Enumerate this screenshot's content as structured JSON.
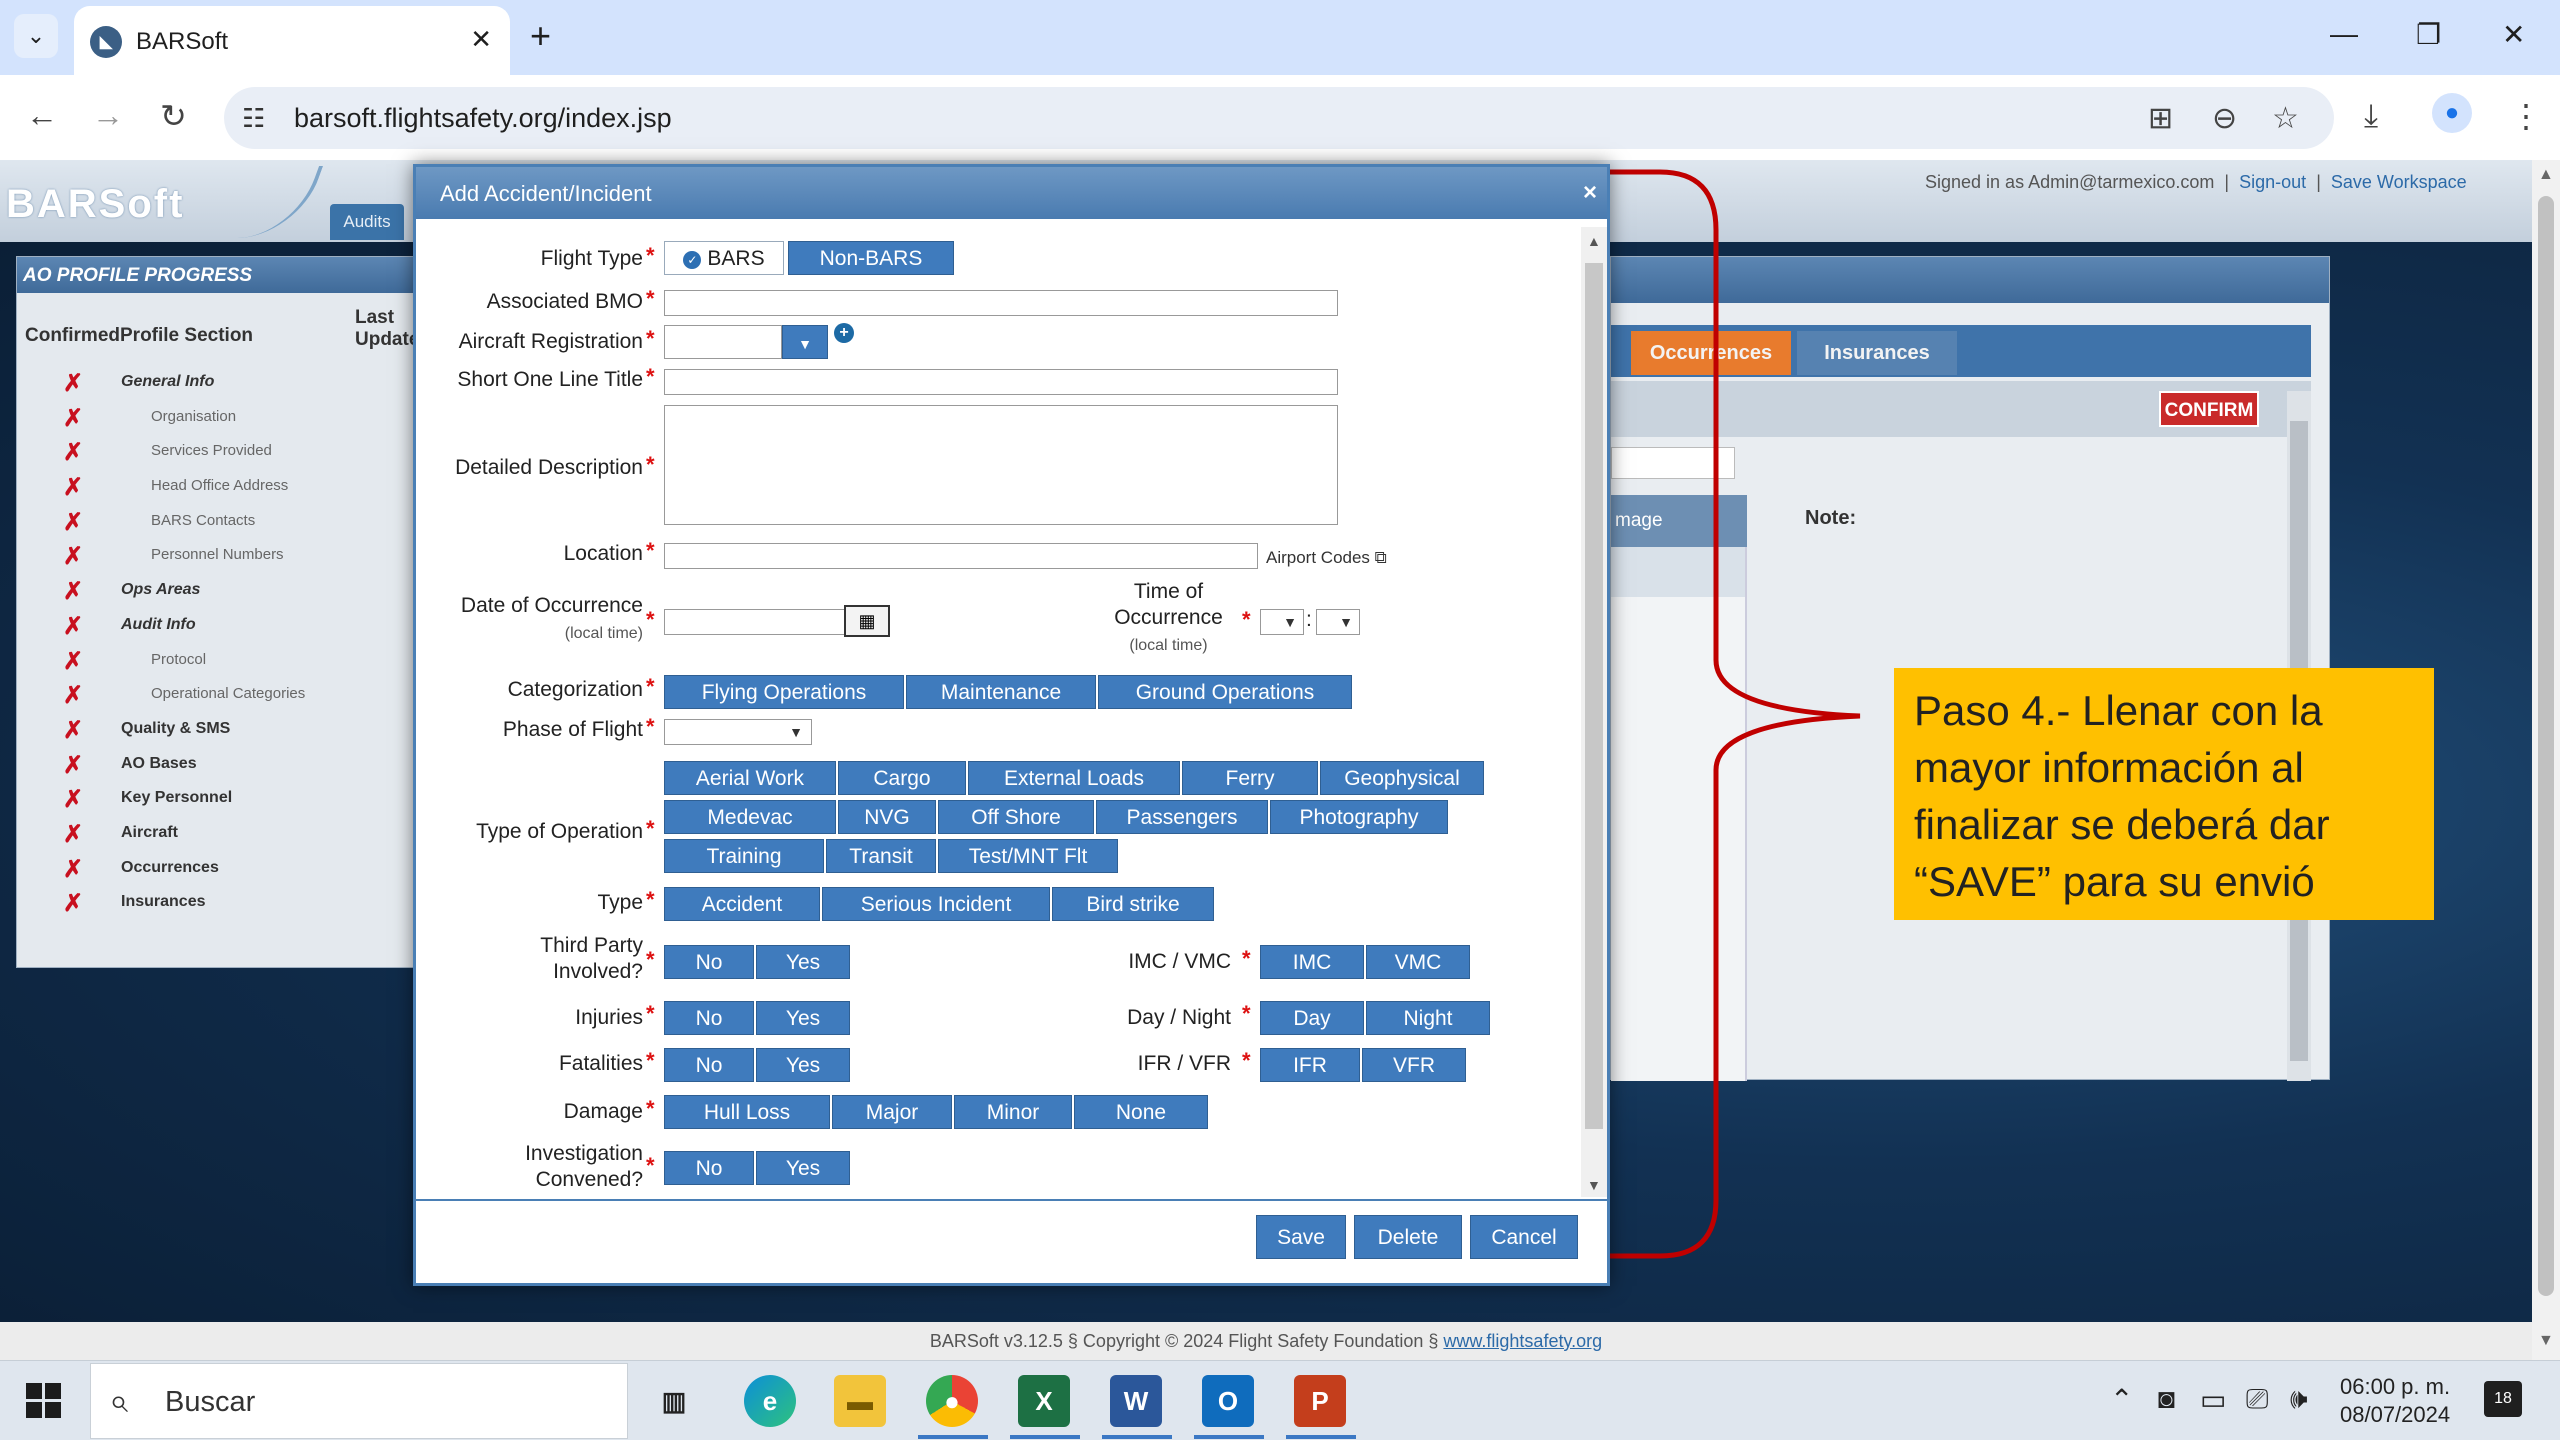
{
  "browser": {
    "tab_title": "BARSoft",
    "url": "barsoft.flightsafety.org/index.jsp"
  },
  "app": {
    "logo": "BARSoft",
    "audits_tab": "Audits",
    "signed_in": "Signed in as Admin@tarmexico.com",
    "sign_out": "Sign-out",
    "save_workspace": "Save Workspace",
    "separator": "|",
    "footer_prefix": "BARSoft v3.12.5 § Copyright © 2024 Flight Safety Foundation § ",
    "footer_link": "www.flightsafety.org"
  },
  "progress": {
    "title": "AO PROFILE PROGRESS",
    "col_section": "ConfirmedProfile Section",
    "col_last": "Last Update",
    "x_mark": "✗",
    "items": [
      {
        "label": "General Info",
        "kind": "main-it"
      },
      {
        "label": "Organisation",
        "kind": "sub"
      },
      {
        "label": "Services Provided",
        "kind": "sub"
      },
      {
        "label": "Head Office Address",
        "kind": "sub"
      },
      {
        "label": "BARS Contacts",
        "kind": "sub"
      },
      {
        "label": "Personnel Numbers",
        "kind": "sub"
      },
      {
        "label": "Ops Areas",
        "kind": "main-it"
      },
      {
        "label": "Audit Info",
        "kind": "main-it"
      },
      {
        "label": "Protocol",
        "kind": "sub"
      },
      {
        "label": "Operational Categories",
        "kind": "sub"
      },
      {
        "label": "Quality & SMS",
        "kind": "main"
      },
      {
        "label": "AO Bases",
        "kind": "main"
      },
      {
        "label": "Key Personnel",
        "kind": "main"
      },
      {
        "label": "Aircraft",
        "kind": "main"
      },
      {
        "label": "Occurrences",
        "kind": "main"
      },
      {
        "label": "Insurances",
        "kind": "main"
      }
    ]
  },
  "right_panel": {
    "tab_occurrences": "Occurrences",
    "tab_insurances": "Insurances",
    "confirm": "CONFIRM",
    "col_image": "mage",
    "note": "Note:"
  },
  "modal": {
    "title": "Add Accident/Incident",
    "close": "×",
    "required_mark": "*",
    "flight_type": {
      "label": "Flight Type",
      "options": [
        "BARS",
        "Non-BARS"
      ]
    },
    "associated_bmo": {
      "label": "Associated BMO",
      "value": ""
    },
    "aircraft_registration": {
      "label": "Aircraft Registration",
      "value": ""
    },
    "short_title": {
      "label": "Short One Line Title",
      "value": ""
    },
    "detailed_description": {
      "label": "Detailed Description",
      "value": ""
    },
    "location": {
      "label": "Location",
      "value": "",
      "airport_codes": "Airport Codes"
    },
    "date_of_occurrence": {
      "label": "Date of Occurrence",
      "sub": "(local time)",
      "value": ""
    },
    "time_of_occurrence": {
      "label_1": "Time of",
      "label_2": "Occurrence",
      "sub": "(local time)",
      "colon": ":"
    },
    "categorization": {
      "label": "Categorization",
      "options": [
        "Flying Operations",
        "Maintenance",
        "Ground Operations"
      ]
    },
    "phase_of_flight": {
      "label": "Phase of Flight",
      "value": ""
    },
    "type_of_operation": {
      "label": "Type of Operation",
      "options": [
        "Aerial Work",
        "Cargo",
        "External Loads",
        "Ferry",
        "Geophysical",
        "Medevac",
        "NVG",
        "Off Shore",
        "Passengers",
        "Photography",
        "Training",
        "Transit",
        "Test/MNT Flt"
      ]
    },
    "type": {
      "label": "Type",
      "options": [
        "Accident",
        "Serious Incident",
        "Bird strike"
      ]
    },
    "third_party": {
      "label_1": "Third Party",
      "label_2": "Involved?",
      "options": [
        "No",
        "Yes"
      ]
    },
    "injuries": {
      "label": "Injuries",
      "options": [
        "No",
        "Yes"
      ]
    },
    "fatalities": {
      "label": "Fatalities",
      "options": [
        "No",
        "Yes"
      ]
    },
    "damage": {
      "label": "Damage",
      "options": [
        "Hull Loss",
        "Major",
        "Minor",
        "None"
      ]
    },
    "investigation": {
      "label_1": "Investigation",
      "label_2": "Convened?",
      "options": [
        "No",
        "Yes"
      ]
    },
    "imc_vmc": {
      "label": "IMC / VMC",
      "options": [
        "IMC",
        "VMC"
      ]
    },
    "day_night": {
      "label": "Day / Night",
      "options": [
        "Day",
        "Night"
      ]
    },
    "ifr_vfr": {
      "label": "IFR / VFR",
      "options": [
        "IFR",
        "VFR"
      ]
    },
    "buttons": {
      "save": "Save",
      "delete": "Delete",
      "cancel": "Cancel"
    }
  },
  "annotation": {
    "text": "Paso 4.- Llenar con la mayor información al finalizar se deberá dar “SAVE” para su envió",
    "bracket_color": "#c00000",
    "box_color": "#ffc000"
  },
  "taskbar": {
    "search": "Buscar",
    "time": "06:00 p. m.",
    "date": "08/07/2024",
    "notifications": "18"
  }
}
